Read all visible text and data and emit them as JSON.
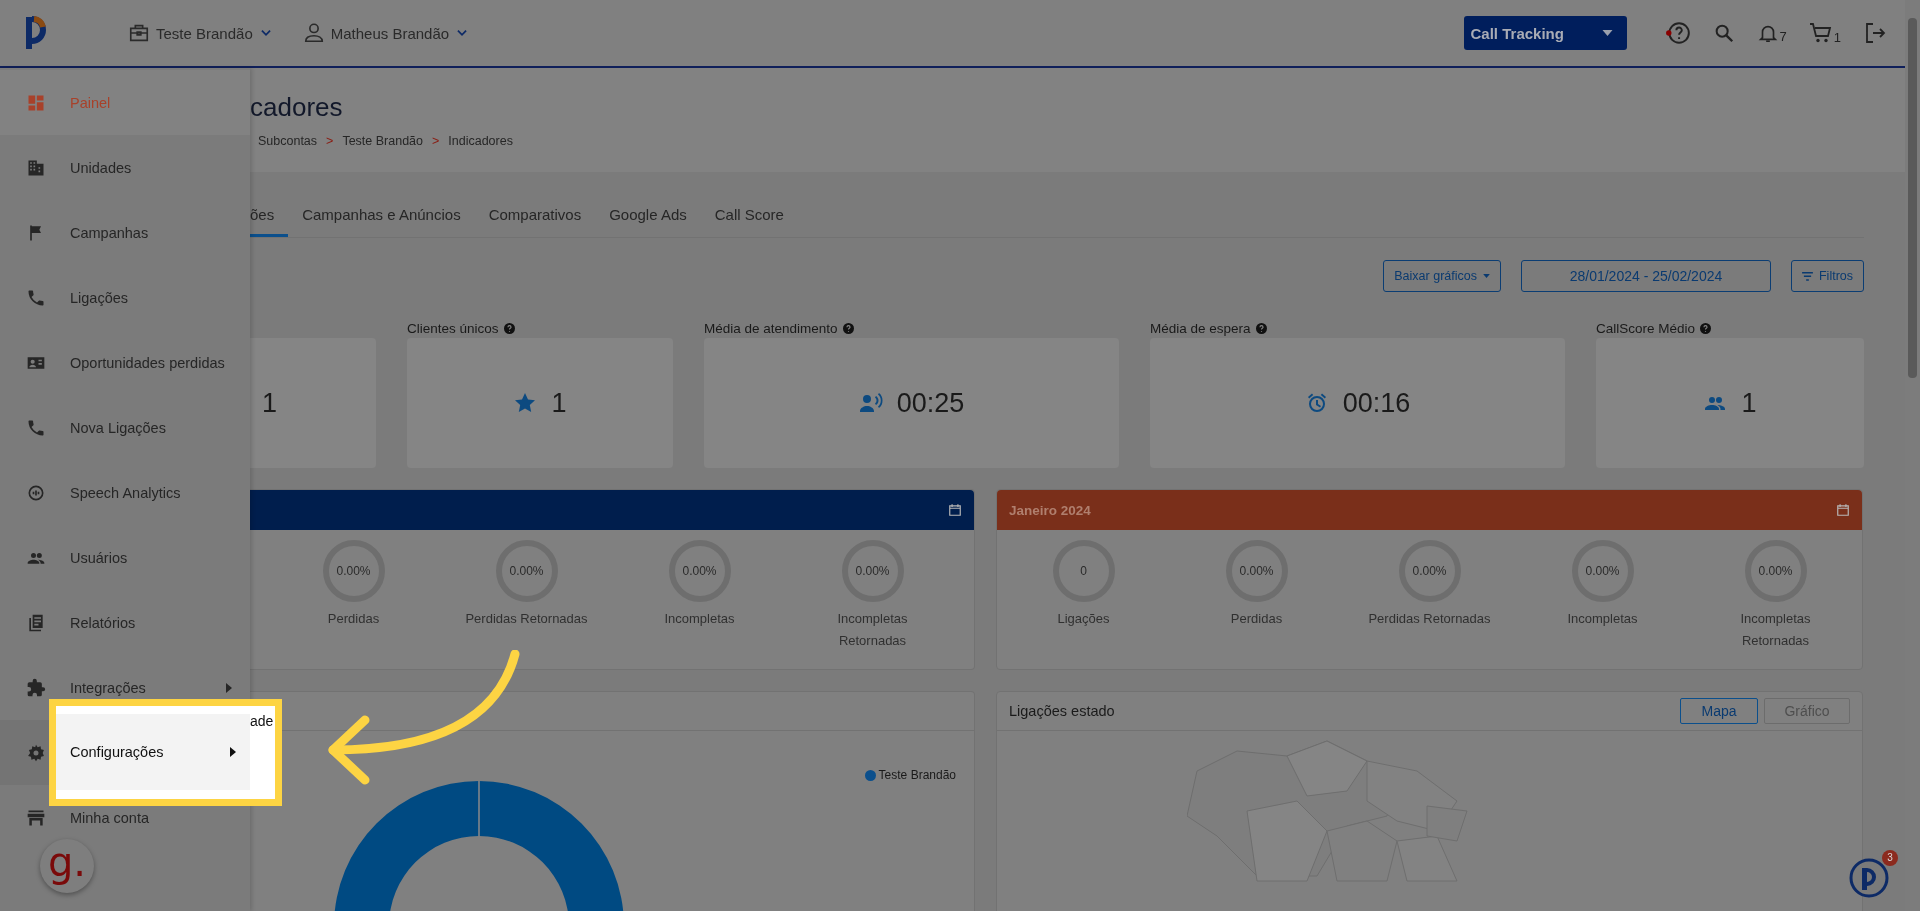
{
  "header": {
    "account": "Teste Brandão",
    "user": "Matheus Brandão",
    "product": "Call Tracking",
    "notifications": "7",
    "cart": "1"
  },
  "sidebar": {
    "items": [
      {
        "label": "Painel",
        "selected": true,
        "submenu": false,
        "highlighted": false
      },
      {
        "label": "Unidades",
        "selected": false,
        "submenu": false,
        "highlighted": false
      },
      {
        "label": "Campanhas",
        "selected": false,
        "submenu": false,
        "highlighted": false
      },
      {
        "label": "Ligações",
        "selected": false,
        "submenu": false,
        "highlighted": false
      },
      {
        "label": "Oportunidades perdidas",
        "selected": false,
        "submenu": false,
        "highlighted": false
      },
      {
        "label": "Nova Ligações",
        "selected": false,
        "submenu": false,
        "highlighted": false
      },
      {
        "label": "Speech Analytics",
        "selected": false,
        "submenu": false,
        "highlighted": false
      },
      {
        "label": "Usuários",
        "selected": false,
        "submenu": false,
        "highlighted": false
      },
      {
        "label": "Relatórios",
        "selected": false,
        "submenu": false,
        "highlighted": false
      },
      {
        "label": "Integrações",
        "selected": false,
        "submenu": true,
        "highlighted": false
      },
      {
        "label": "Configurações",
        "selected": false,
        "submenu": true,
        "highlighted": true
      },
      {
        "label": "Minha conta",
        "selected": false,
        "submenu": false,
        "highlighted": false
      }
    ]
  },
  "page_title": "cadores",
  "breadcrumb": {
    "separator": ">",
    "items": [
      "Subcontas",
      "Teste Brandão",
      "Indicadores"
    ]
  },
  "tabs": [
    {
      "label": "ões",
      "selected": true
    },
    {
      "label": "Campanhas e Anúncios",
      "selected": false
    },
    {
      "label": "Comparativos",
      "selected": false
    },
    {
      "label": "Google Ads",
      "selected": false
    },
    {
      "label": "Call Score",
      "selected": false
    }
  ],
  "toolbar": {
    "download": "Baixar gráficos",
    "date_range": "28/01/2024 - 25/02/2024",
    "filters": "Filtros"
  },
  "kpis": [
    {
      "value": "1"
    },
    {
      "label": "Clientes únicos",
      "value": "1"
    },
    {
      "label": "Média de atendimento",
      "value": "00:25"
    },
    {
      "label": "Média de espera",
      "value": "00:16"
    },
    {
      "label": "CallScore Médio",
      "value": "1"
    }
  ],
  "periods": [
    {
      "color": "#001e4d",
      "metrics": [
        {
          "value": "0.00%",
          "label": "Perdidas"
        },
        {
          "value": "0.00%",
          "label": "Perdidas Retornadas"
        },
        {
          "value": "0.00%",
          "label": "Incompletas"
        },
        {
          "value": "0.00%",
          "label": "Incompletas Retornadas"
        }
      ]
    },
    {
      "title": "Janeiro 2024",
      "color": "#7a2f1a",
      "metrics": [
        {
          "value": "0",
          "label": "Ligações"
        },
        {
          "value": "0.00%",
          "label": "Perdidas"
        },
        {
          "value": "0.00%",
          "label": "Perdidas Retornadas"
        },
        {
          "value": "0.00%",
          "label": "Incompletas"
        },
        {
          "value": "0.00%",
          "label": "Incompletas Retornadas"
        }
      ]
    }
  ],
  "charts": [
    {
      "title": "ade",
      "legend": "Teste Brandão"
    },
    {
      "title": "Ligações estado",
      "buttons": [
        {
          "label": "Mapa",
          "selected": true
        },
        {
          "label": "Gráfico",
          "selected": false
        }
      ]
    }
  ],
  "guide_logo": "g.",
  "help_badge": "3"
}
